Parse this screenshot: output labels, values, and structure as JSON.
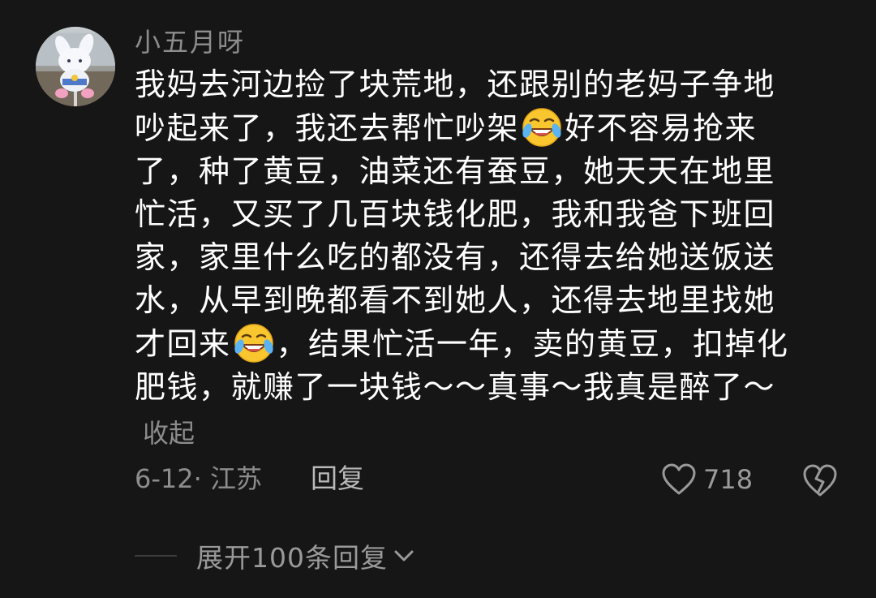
{
  "comment": {
    "username": "小五月呀",
    "lines": [
      {
        "a": "我妈去河边捡了块荒地，还跟别的老妈子争地"
      },
      {
        "a": "吵起来了，我还去帮忙吵架",
        "b": "好不容易抢来"
      },
      {
        "a": "了，种了黄豆，油菜还有蚕豆，她天天在地里"
      },
      {
        "a": "忙活，又买了几百块钱化肥，我和我爸下班回"
      },
      {
        "a": "家，家里什么吃的都没有，还得去给她送饭送"
      },
      {
        "a": "水，从早到晚都看不到她人，还得去地里找她"
      },
      {
        "a": "才回来",
        "b": "，结果忙活一年，卖的黄豆，扣掉化"
      },
      {
        "a": "肥钱，就赚了一块钱～～真事～我真是醉了～"
      }
    ],
    "emoji_icon": "laughing-tears-emoji-icon",
    "collapse_label": "收起",
    "date_location": "6-12· 江苏",
    "reply_label": "回复",
    "like_count": "718",
    "like_icon": "heart-outline-icon",
    "dislike_icon": "broken-heart-icon",
    "expand_label": "展开100条回复"
  },
  "colors": {
    "background": "#161616",
    "text_primary": "#ffffff",
    "text_secondary": "#8d8d8d"
  }
}
